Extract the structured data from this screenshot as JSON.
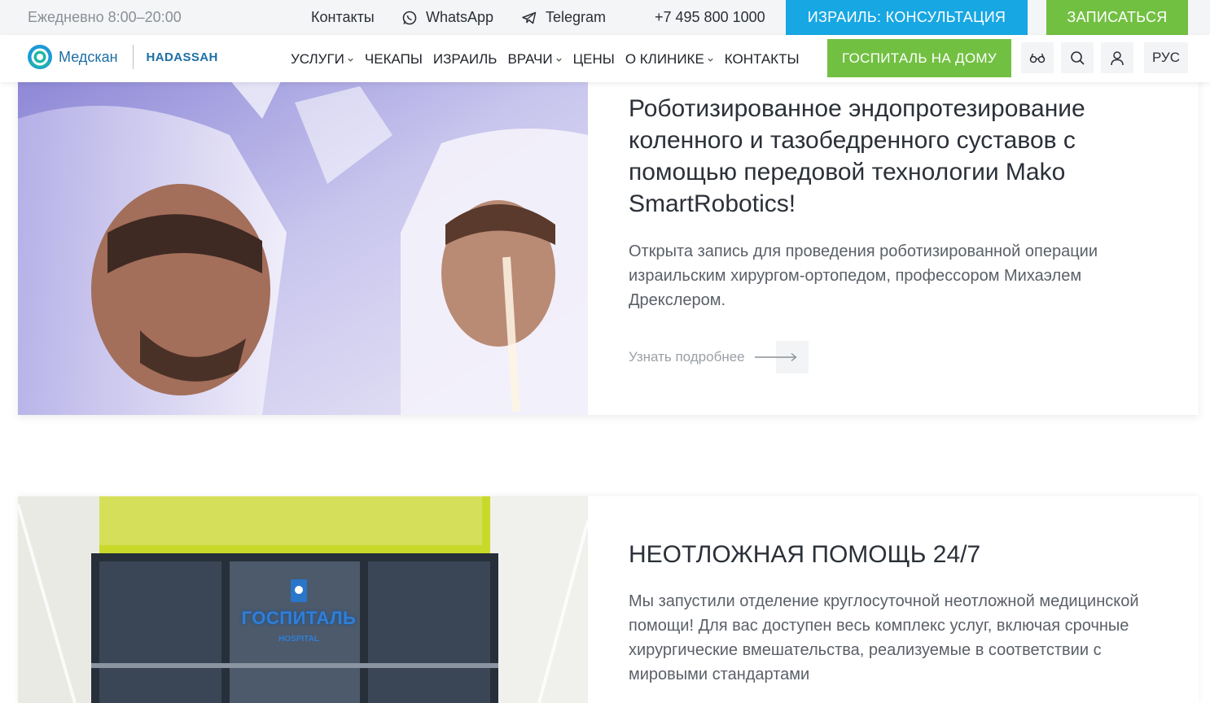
{
  "topbar": {
    "hours": "Ежедневно 8:00–20:00",
    "contacts": "Контакты",
    "whatsapp": "WhatsApp",
    "telegram": "Telegram",
    "phone": "+7 495 800 1000",
    "israel_button": "ИЗРАИЛЬ: КОНСУЛЬТАЦИЯ",
    "signup_button": "ЗАПИСАТЬСЯ"
  },
  "header": {
    "logo_text": "Медскан",
    "logo_partner": "HADASSAH",
    "menu": [
      {
        "label": "УСЛУГИ",
        "dropdown": true
      },
      {
        "label": "ЧЕКАПЫ",
        "dropdown": false
      },
      {
        "label": "ИЗРАИЛЬ",
        "dropdown": false
      },
      {
        "label": "ВРАЧИ",
        "dropdown": true
      },
      {
        "label": "ЦЕНЫ",
        "dropdown": false
      },
      {
        "label": "О КЛИНИКЕ",
        "dropdown": true
      },
      {
        "label": "КОНТАКТЫ",
        "dropdown": false
      }
    ],
    "hospital_button": "ГОСПИТАЛЬ НА ДОМУ",
    "icons": [
      "glasses-icon",
      "search-icon",
      "user-icon"
    ],
    "language": "РУС"
  },
  "cards": [
    {
      "title": "Роботизированное эндопротезирование коленного и тазобедренного суставов с помощью передовой технологии Mako SmartRobotics!",
      "text": "Открыта запись для проведения роботизированной операции израильским хирургом-ортопедом, профессором Михаэлем Дрекслером.",
      "more": "Узнать подробнее"
    },
    {
      "title": "НЕОТЛОЖНАЯ ПОМОЩЬ 24/7",
      "text": "Мы запустили отделение круглосуточной неотложной медицинской помощи! Для вас доступен весь комплекс услуг, включая срочные хирургические вмешательства, реализуемые в соответствии с мировыми стандартами",
      "image_sign": "ГОСПИТАЛЬ",
      "image_sign_sub": "HOSPITAL"
    }
  ],
  "colors": {
    "accent_blue": "#17a7e3",
    "accent_green": "#72c042",
    "brand_blue": "#1d6fa5"
  }
}
